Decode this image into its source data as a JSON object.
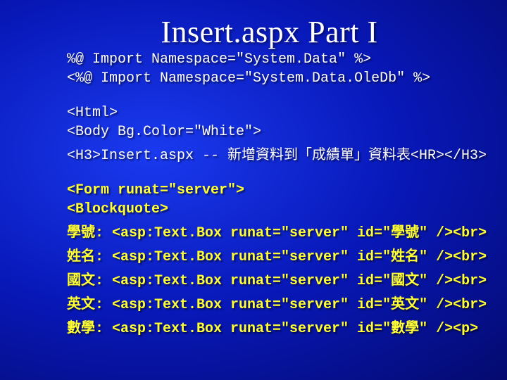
{
  "title": "Insert.aspx Part I",
  "lines": [
    {
      "cls": "white",
      "text": "%@ Import Namespace=\"System.Data\" %>"
    },
    {
      "cls": "white",
      "text": "<%@ Import Namespace=\"System.Data.OleDb\" %>"
    },
    {
      "cls": "spacer",
      "text": ""
    },
    {
      "cls": "white",
      "text": "<Html>"
    },
    {
      "cls": "white",
      "text": "<Body Bg.Color=\"White\">"
    },
    {
      "cls": "white",
      "text": "<H3>Insert.aspx -- 新增資料到「成績單」資料表<HR></H3>"
    },
    {
      "cls": "spacer",
      "text": ""
    },
    {
      "cls": "yellow",
      "text": "<Form runat=\"server\">"
    },
    {
      "cls": "yellow",
      "text": "<Blockquote>"
    },
    {
      "cls": "yellow",
      "text": "學號: <asp:Text.Box runat=\"server\" id=\"學號\" /><br>"
    },
    {
      "cls": "yellow",
      "text": "姓名: <asp:Text.Box runat=\"server\" id=\"姓名\" /><br>"
    },
    {
      "cls": "yellow",
      "text": "國文: <asp:Text.Box runat=\"server\" id=\"國文\" /><br>"
    },
    {
      "cls": "yellow",
      "text": "英文: <asp:Text.Box runat=\"server\" id=\"英文\" /><br>"
    },
    {
      "cls": "yellow",
      "text": "數學: <asp:Text.Box runat=\"server\" id=\"數學\" /><p>"
    }
  ]
}
